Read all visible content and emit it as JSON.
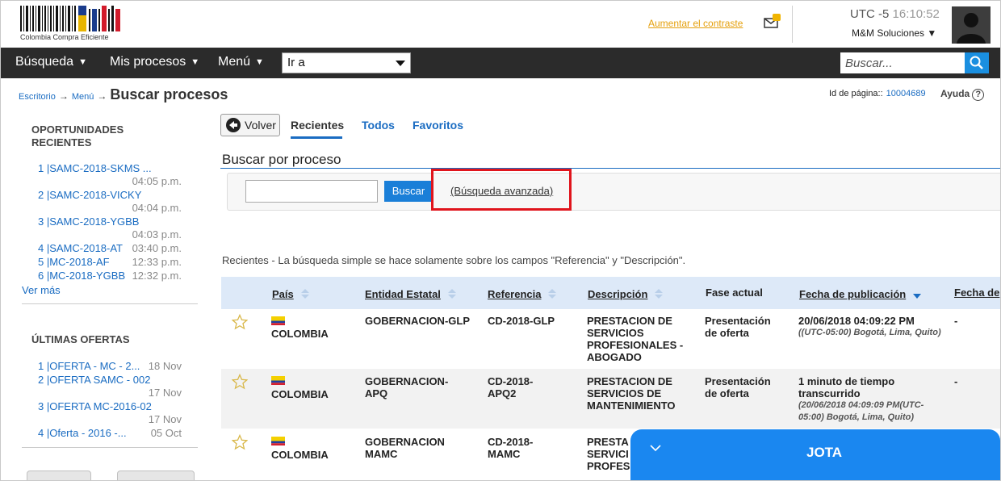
{
  "header": {
    "logo_text": "Colombia Compra Eficiente",
    "contrast_link": "Aumentar el contraste",
    "timezone": "UTC -5",
    "time": "16:10:52",
    "company": "M&M Soluciones ▼"
  },
  "nav": {
    "items": [
      "Búsqueda",
      "Mis procesos",
      "Menú"
    ],
    "goto_label": "Ir a",
    "search_placeholder": "Buscar..."
  },
  "breadcrumb": {
    "escritorio": "Escritorio",
    "menu": "Menú",
    "title": "Buscar procesos"
  },
  "page": {
    "id_label": "Id de página::",
    "id_value": "10004689",
    "help": "Ayuda"
  },
  "sidebar": {
    "opportunities_title": "OPORTUNIDADES RECIENTES",
    "opportunities": [
      {
        "label": "1 |SAMC-2018-SKMS ...",
        "time": "04:05 p.m."
      },
      {
        "label": "2 |SAMC-2018-VICKY",
        "time": "04:04 p.m."
      },
      {
        "label": "3 |SAMC-2018-YGBB",
        "time": "04:03 p.m."
      },
      {
        "label": "4 |SAMC-2018-AT",
        "time": "03:40 p.m."
      },
      {
        "label": "5 |MC-2018-AF",
        "time": "12:33 p.m."
      },
      {
        "label": "6 |MC-2018-YGBB",
        "time": "12:32 p.m."
      }
    ],
    "see_more": "Ver más",
    "offers_title": "ÚLTIMAS OFERTAS",
    "offers": [
      {
        "label": "1 |OFERTA - MC - 2...",
        "date": "18 Nov"
      },
      {
        "label": "2 |OFERTA SAMC - 002",
        "date": "17 Nov"
      },
      {
        "label": "3 |OFERTA MC-2016-02",
        "date": "17 Nov"
      },
      {
        "label": "4 |Oferta - 2016 -...",
        "date": "05 Oct"
      }
    ]
  },
  "main": {
    "back_button": "Volver",
    "tabs": [
      "Recientes",
      "Todos",
      "Favoritos"
    ],
    "active_tab": "Recientes",
    "section_title": "Buscar por proceso",
    "search_button": "Buscar",
    "advanced_link": "(Búsqueda avanzada)",
    "note": "Recientes - La búsqueda simple se hace solamente sobre los campos \"Referencia\" y \"Descripción\"."
  },
  "table": {
    "columns": [
      "País",
      "Entidad Estatal",
      "Referencia",
      "Descripción",
      "Fase actual",
      "Fecha de publicación",
      "Fecha de"
    ],
    "rows": [
      {
        "country": "COLOMBIA",
        "entity": "GOBERNACION-GLP",
        "reference": "CD-2018-GLP",
        "description": "PRESTACION DE SERVICIOS PROFESIONALES - ABOGADO",
        "phase": "Presentación de oferta",
        "pub_main": "20/06/2018 04:09:22 PM",
        "pub_sub": "((UTC-05:00) Bogotá, Lima, Quito)",
        "last": "-"
      },
      {
        "country": "COLOMBIA",
        "entity": "GOBERNACION-APQ",
        "reference": "CD-2018-APQ2",
        "description": "PRESTACION DE SERVICIOS DE MANTENIMIENTO",
        "phase": "Presentación de oferta",
        "pub_main": "1 minuto de tiempo transcurrido",
        "pub_sub": "(20/06/2018 04:09:09 PM(UTC-05:00) Bogotá, Lima, Quito)",
        "last": "-"
      },
      {
        "country": "COLOMBIA",
        "entity": "GOBERNACION MAMC",
        "reference": "CD-2018-MAMC",
        "description": "PRESTA SERVICI PROFES",
        "phase": "",
        "pub_main": "",
        "pub_sub": "",
        "last": ""
      }
    ]
  },
  "chat": {
    "name": "JOTA"
  },
  "colors": {
    "nav_bg": "#2b2b2b",
    "link": "#1a6cc2",
    "accent_blue": "#1a87f0",
    "highlight_red": "#e0141c",
    "contrast_orange": "#e5a00d",
    "table_header": "#dde9f8"
  },
  "icons": [
    "barcode-logo",
    "envelope-notification-icon",
    "avatar",
    "caret-down-icon",
    "magnifier-icon",
    "back-arrow-icon",
    "sort-icon",
    "star-icon",
    "flag-colombia-icon",
    "chevron-down-icon",
    "help-icon"
  ]
}
